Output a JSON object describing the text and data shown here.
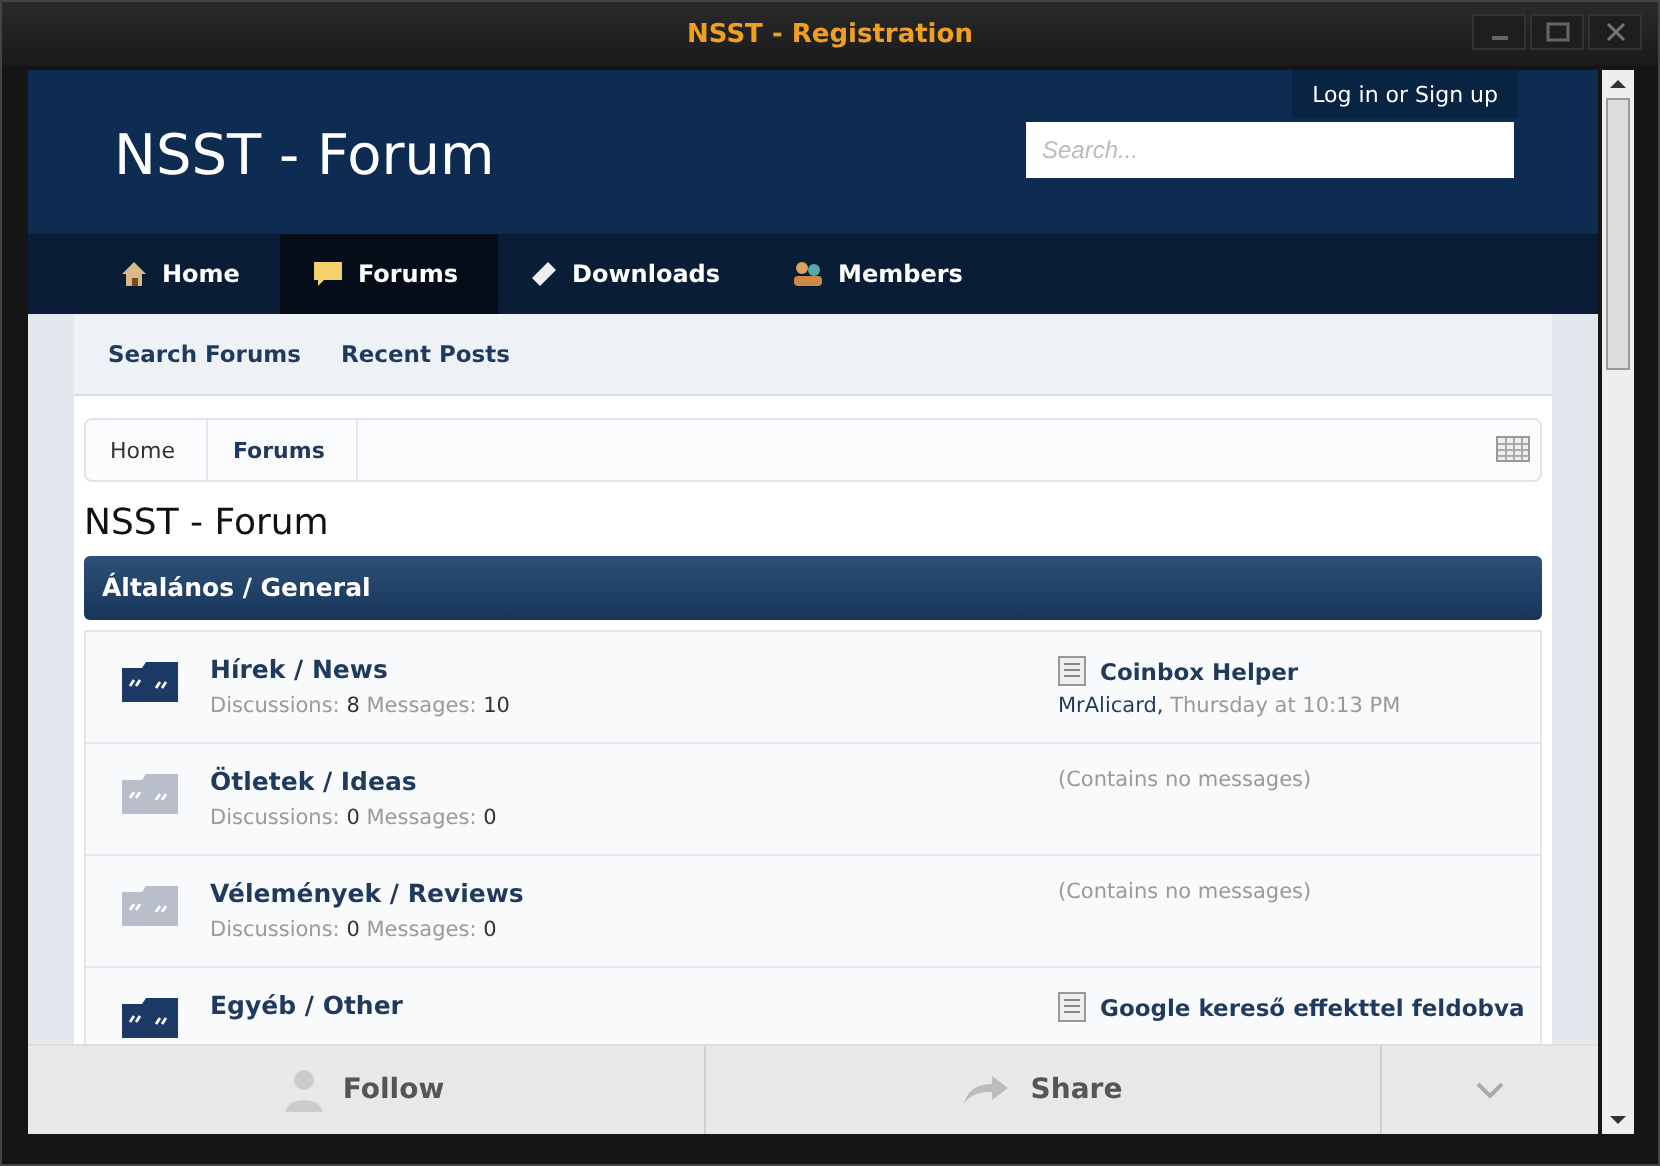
{
  "window": {
    "title": "NSST - Registration"
  },
  "header": {
    "logo": "NSST - Forum",
    "login": "Log in or Sign up",
    "search": {
      "placeholder": "Search..."
    }
  },
  "nav": [
    {
      "label": "Home",
      "selected": false
    },
    {
      "label": "Forums",
      "selected": true
    },
    {
      "label": "Downloads",
      "selected": false
    },
    {
      "label": "Members",
      "selected": false
    }
  ],
  "subnav": [
    "Search Forums",
    "Recent Posts"
  ],
  "breadcrumb": [
    {
      "label": "Home",
      "current": false
    },
    {
      "label": "Forums",
      "current": true
    }
  ],
  "page_title": "NSST - Forum",
  "category": "Általános / General",
  "forums": [
    {
      "title": "Hírek / News",
      "unread": true,
      "stats": {
        "discussions_label": "Discussions:",
        "discussions": "8",
        "messages_label": "Messages:",
        "messages": "10"
      },
      "last": {
        "kind": "post",
        "title": "Coinbox Helper",
        "user": "MrAlicard,",
        "time": "Thursday at 10:13 PM"
      }
    },
    {
      "title": "Ötletek / Ideas",
      "unread": false,
      "stats": {
        "discussions_label": "Discussions:",
        "discussions": "0",
        "messages_label": "Messages:",
        "messages": "0"
      },
      "last": {
        "kind": "empty",
        "text": "(Contains no messages)"
      }
    },
    {
      "title": "Vélemények / Reviews",
      "unread": false,
      "stats": {
        "discussions_label": "Discussions:",
        "discussions": "0",
        "messages_label": "Messages:",
        "messages": "0"
      },
      "last": {
        "kind": "empty",
        "text": "(Contains no messages)"
      }
    },
    {
      "title": "Egyéb / Other",
      "unread": true,
      "last": {
        "kind": "post",
        "title": "Google kereső effekttel feldobva"
      }
    }
  ],
  "bottom_bar": {
    "follow": "Follow",
    "share": "Share"
  }
}
